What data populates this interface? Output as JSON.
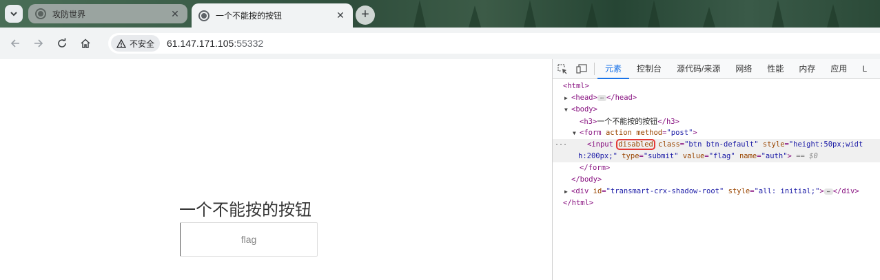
{
  "browser": {
    "tabs": [
      {
        "title": "攻防世界",
        "active": false
      },
      {
        "title": "一个不能按的按钮",
        "active": true
      }
    ],
    "tab_close_glyph": "✕",
    "new_tab_glyph": "+",
    "security_label": "不安全",
    "url_host": "61.147.171.105",
    "url_port": ":55332"
  },
  "page": {
    "heading": "一个不能按的按钮",
    "button_value": "flag"
  },
  "devtools": {
    "tabs": [
      "元素",
      "控制台",
      "源代码/来源",
      "网络",
      "性能",
      "内存",
      "应用",
      "L"
    ],
    "active_tab": "元素",
    "dom": {
      "html_open": "<html>",
      "head_open": "<head>",
      "head_close": "</head>",
      "body_open": "<body>",
      "h3_open": "<h3>",
      "h3_text": "一个不能按的按钮",
      "h3_close": "</h3>",
      "form_open": "<form",
      "form_attr_action": "action",
      "form_attr_method": "method",
      "form_method_value": "\"post\"",
      "form_end": ">",
      "input_open": "<input",
      "input_disabled": "disabled",
      "input_class_attr": "class",
      "input_class_value": "\"btn btn-default\"",
      "input_style_attr": "style",
      "input_style_value_1": "\"height:50px;widt",
      "input_style_value_2": "h:200px;\"",
      "input_type_attr": "type",
      "input_type_value": "\"submit\"",
      "input_value_attr": "value",
      "input_value_value": "\"flag\"",
      "input_name_attr": "name",
      "input_name_value": "\"auth\"",
      "input_end": ">",
      "selected_marker": "== $0",
      "form_close": "</form>",
      "body_close": "</body>",
      "div_open": "<div",
      "div_id_attr": "id",
      "div_id_value": "\"transmart-crx-shadow-root\"",
      "div_style_attr": "style",
      "div_style_value": "\"all: initial;\"",
      "div_end": ">",
      "div_close": "</div>",
      "html_close": "</html>",
      "ellipsis": "⋯",
      "gutter": "···"
    }
  },
  "colors": {
    "devtools_active": "#1a73e8",
    "highlight_box": "#e53935"
  }
}
